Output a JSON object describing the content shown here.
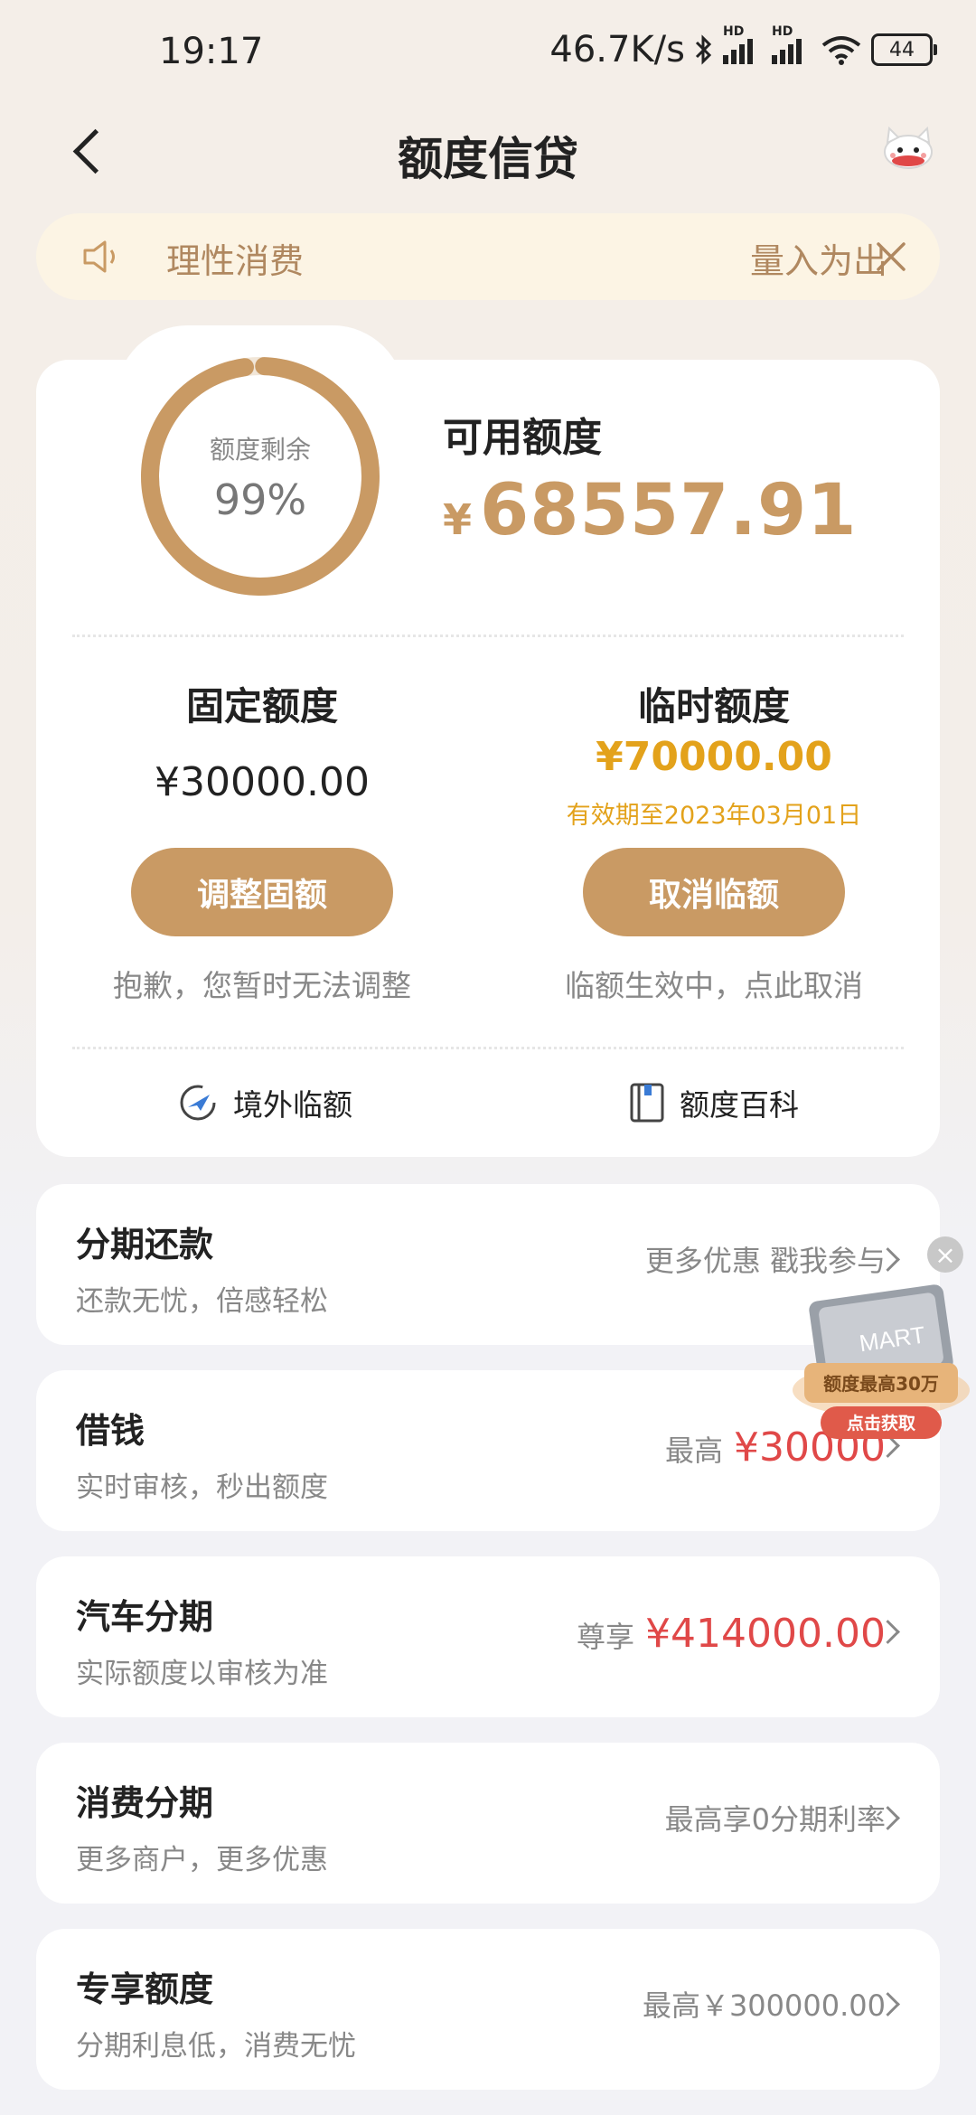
{
  "status": {
    "time": "19:17",
    "speed": "46.7K/s",
    "battery": "44",
    "hd1": "HD",
    "hd2": "HD"
  },
  "nav": {
    "title": "额度信贷"
  },
  "notice": {
    "text": "理性消费",
    "text2": "量入为出"
  },
  "quota": {
    "ring_label": "额度剩余",
    "ring_percent": "99%",
    "ring_value": 0.99,
    "available_label": "可用额度",
    "available_currency": "¥",
    "available_amount": "68557.91",
    "fixed": {
      "title": "固定额度",
      "amount": "¥30000.00",
      "button": "调整固额",
      "note": "抱歉，您暂时无法调整"
    },
    "temp": {
      "title": "临时额度",
      "amount": "¥70000.00",
      "valid": "有效期至2023年03月01日",
      "button": "取消临额",
      "note": "临额生效中，点此取消"
    },
    "links": {
      "overseas": "境外临额",
      "wiki": "额度百科"
    }
  },
  "rows": [
    {
      "title": "分期还款",
      "sub": "还款无忧，倍感轻松",
      "right_text": "更多优惠 戳我参与",
      "right_amount": ""
    },
    {
      "title": "借钱",
      "sub": "实时审核，秒出额度",
      "right_text": "最高",
      "right_amount": "¥30000"
    },
    {
      "title": "汽车分期",
      "sub": "实际额度以审核为准",
      "right_text": "尊享",
      "right_amount": "¥414000.00"
    },
    {
      "title": "消费分期",
      "sub": "更多商户，更多优惠",
      "right_text": "最高享0分期利率",
      "right_amount": ""
    },
    {
      "title": "专享额度",
      "sub": "分期利息低，消费无忧",
      "right_text": "最高￥300000.00",
      "right_amount": ""
    }
  ],
  "ad": {
    "card_text": "MART",
    "line1": "额度最高30万",
    "button": "点击获取"
  },
  "colors": {
    "accent": "#c99a64",
    "gold": "#e3a21b",
    "red": "#e04848",
    "notice_bg": "#fcf4e4"
  }
}
